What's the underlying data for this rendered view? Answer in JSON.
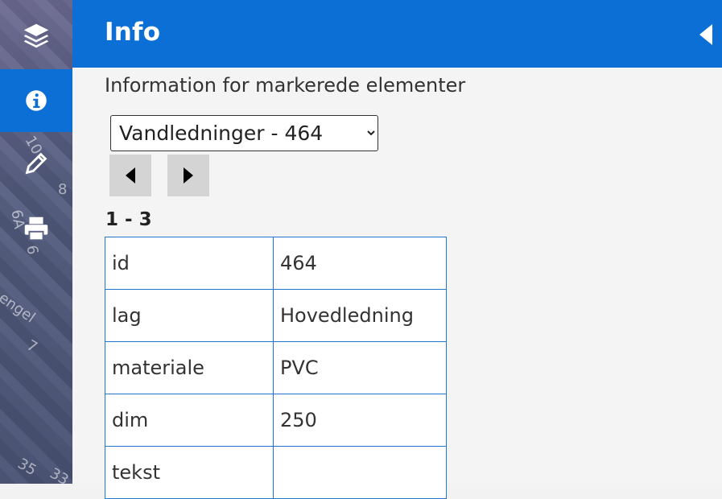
{
  "map": {
    "labels": [
      "10",
      "8",
      "6A",
      "6",
      "engel",
      "7",
      "35",
      "33"
    ]
  },
  "toolbar": {
    "items": [
      {
        "name": "layers",
        "icon": "layers-icon",
        "active": false
      },
      {
        "name": "info",
        "icon": "info-icon",
        "active": true
      },
      {
        "name": "draw",
        "icon": "pencil-icon",
        "active": false
      },
      {
        "name": "print",
        "icon": "printer-icon",
        "active": false
      }
    ]
  },
  "panel": {
    "title": "Info",
    "collapse_icon": "triangle-left-icon",
    "subtitle": "Information for markerede elementer",
    "layer_select": {
      "selected": "Vandledninger - 464",
      "options": [
        "Vandledninger - 464"
      ]
    },
    "prev_icon": "triangle-left-icon",
    "next_icon": "triangle-right-icon",
    "range": "1 - 3",
    "rows": [
      {
        "key": "id",
        "value": "464"
      },
      {
        "key": "lag",
        "value": "Hovedledning"
      },
      {
        "key": "materiale",
        "value": "PVC"
      },
      {
        "key": "dim",
        "value": "250"
      },
      {
        "key": "tekst",
        "value": ""
      }
    ]
  },
  "colors": {
    "accent": "#0b6fd6",
    "table_border": "#1f77d0",
    "nav_button_bg": "#d4d4d4"
  }
}
